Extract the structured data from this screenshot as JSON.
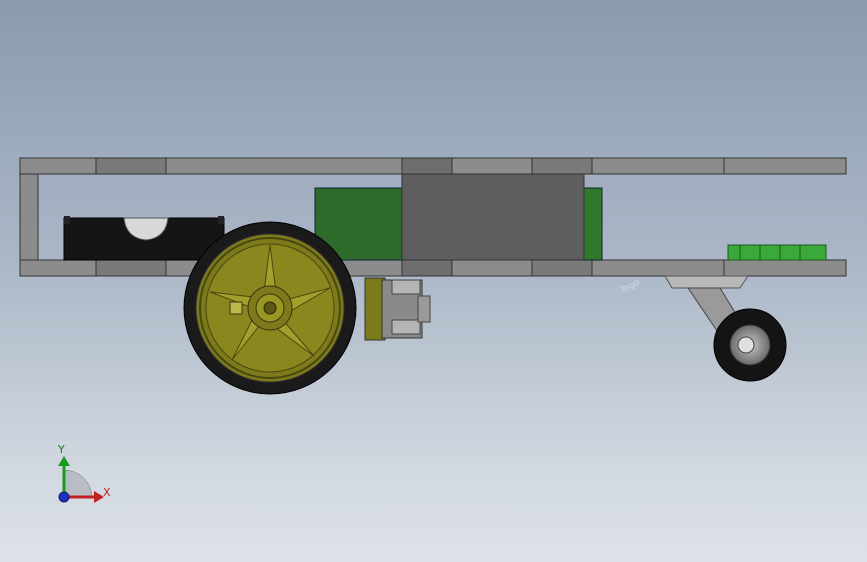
{
  "viewport": {
    "background_top": "#8a9bb0",
    "background_bottom": "#dde2e8"
  },
  "model": {
    "parts": [
      "chassis-frame",
      "battery-holder",
      "control-board",
      "drive-wheel",
      "gear-motor",
      "caster-wheel",
      "sensor-board"
    ],
    "colors": {
      "frame": "#6e6e6e",
      "frame_light": "#8c8c8c",
      "board_green": "#2e6b2a",
      "rim_olive": "#7d7a1c",
      "tire": "#1a1a1a",
      "motor_metal": "#8a8a8a"
    }
  },
  "triad": {
    "x_label": "X",
    "y_label": "Y",
    "x_color": "#c02020",
    "y_color": "#1a9a1a",
    "z_color": "#2030c0"
  },
  "watermark": {
    "text": "Togo"
  }
}
